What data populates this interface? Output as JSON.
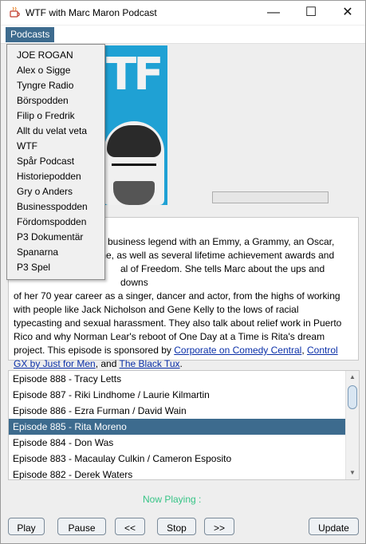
{
  "window": {
    "title": "WTF with Marc Maron Podcast",
    "controls": {
      "minimize": "—",
      "maximize": "☐",
      "close": "✕"
    }
  },
  "menubar": {
    "podcasts_label": "Podcasts"
  },
  "podcast_menu": {
    "items": [
      "JOE ROGAN",
      "Alex o Sigge",
      "Tyngre Radio",
      "Börspodden",
      "Filip o Fredrik",
      "Allt du velat veta",
      "WTF",
      "Spår Podcast",
      "Historiepodden",
      "Gry o Anders",
      "Businesspodden",
      "Fördomspodden",
      "P3 Dokumentär",
      "Spanarna",
      "P3 Spel"
    ]
  },
  "artwork": {
    "letters": "TF"
  },
  "playback": {
    "progress_fraction": 0.0
  },
  "description": {
    "lines": [
      "w business legend with an Emmy, a Grammy, an Oscar,",
      "me, as well as several lifetime achievement awards and",
      "al of Freedom. She tells Marc about the ups and downs",
      "of her 70 year career as a singer, dancer and actor, from the highs of working",
      "with people like Jack Nicholson and Gene Kelly to the lows of racial",
      "typecasting and sexual harassment. They also talk about relief work in Puerto",
      "Rico and why Norman Lear's reboot of One Day at a Time is Rita's dream"
    ],
    "sponsor_prefix": "project. This episode is sponsored by ",
    "link1": "Corporate on Comedy Central",
    "sep1": ", ",
    "link2a": "Control",
    "link2b": "GX by Just for Men",
    "sep2": ", and ",
    "link3": "The Black Tux",
    "end": "."
  },
  "episodes": {
    "items": [
      "Episode 888 - Tracy Letts",
      "Episode 887 - Riki Lindhome / Laurie Kilmartin",
      "Episode 886 - Ezra Furman / David Wain",
      "Episode 885 - Rita Moreno",
      "Episode 884 - Don Was",
      "Episode 883 - Macaulay Culkin / Cameron Esposito",
      "Episode 882 - Derek Waters"
    ],
    "selected_index": 3
  },
  "status": {
    "now_playing": "Now Playing :"
  },
  "buttons": {
    "play": "Play",
    "pause": "Pause",
    "prev": "<<",
    "stop": "Stop",
    "next": ">>",
    "update": "Update"
  },
  "colors": {
    "selection": "#3d6b8e",
    "now_playing": "#36c486",
    "link": "#0a2fa8"
  }
}
